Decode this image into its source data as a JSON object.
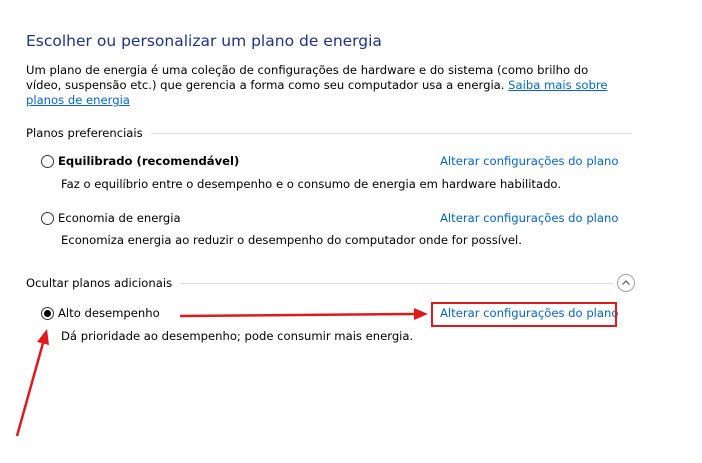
{
  "page": {
    "title": "Escolher ou personalizar um plano de energia",
    "intro_text": "Um plano de energia é uma coleção de configurações de hardware e do sistema (como brilho do vídeo, suspensão etc.) que gerencia a forma como seu computador usa a energia. ",
    "intro_link": "Saiba mais sobre planos de energia"
  },
  "preferred": {
    "header": "Planos preferenciais",
    "plans": [
      {
        "name": "Equilibrado (recomendável)",
        "description": "Faz o equilíbrio entre o desempenho e o consumo de energia em hardware habilitado.",
        "link": "Alterar configurações do plano",
        "selected": false
      },
      {
        "name": "Economia de energia",
        "description": "Economiza energia ao reduzir o desempenho do computador onde for possível.",
        "link": "Alterar configurações do plano",
        "selected": false
      }
    ]
  },
  "additional": {
    "header": "Ocultar planos adicionais",
    "collapse_icon": "chevron-up-icon",
    "plans": [
      {
        "name": "Alto desempenho",
        "description": "Dá prioridade ao desempenho; pode consumir mais energia.",
        "link": "Alterar configurações do plano",
        "selected": true
      }
    ]
  },
  "annotation": {
    "color": "#e0191b"
  }
}
